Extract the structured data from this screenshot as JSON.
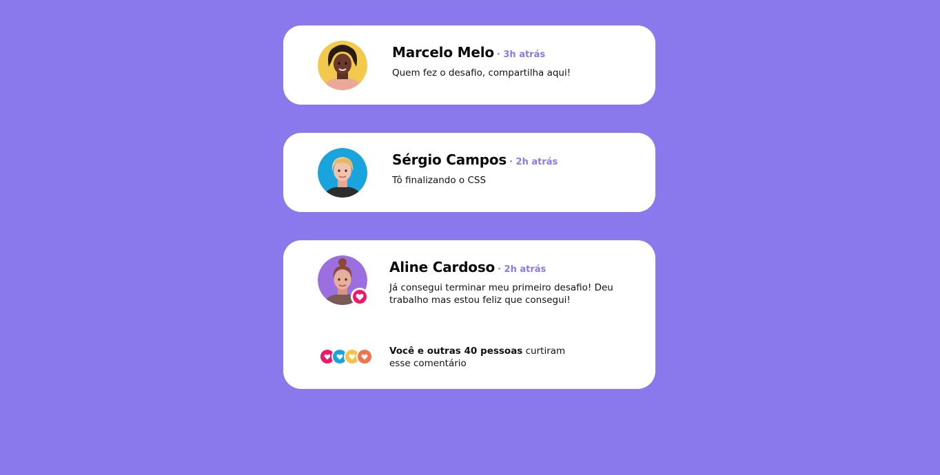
{
  "colors": {
    "background": "#8a79ed",
    "card": "#ffffff",
    "accent": "#8a79ed",
    "heart": "#f0176b"
  },
  "comments": [
    {
      "name": "Marcelo Melo",
      "time": "· 3h atrás",
      "message": "Quem fez o desafio, compartilha aqui!",
      "avatar_icon": "avatar-curly-hair-man",
      "avatar_bg": "#f2c94c"
    },
    {
      "name": "Sérgio Campos",
      "time": "· 2h atrás",
      "message": "Tô finalizando o CSS",
      "avatar_icon": "avatar-blond-man",
      "avatar_bg": "#1aa4dd"
    },
    {
      "name": "Aline Cardoso",
      "time": "· 2h atrás",
      "message": "Já consegui terminar meu primeiro desafio! Deu trabalho mas estou feliz que consegui!",
      "avatar_icon": "avatar-bun-hair-woman",
      "avatar_bg": "#9b6fe0",
      "badge_icon": "heart-icon",
      "likes": {
        "bold": "Você e outras 40 pessoas",
        "rest": " curtiram esse comentário",
        "reactions": [
          {
            "icon": "heart-icon",
            "color": "#f0176b"
          },
          {
            "icon": "heart-icon",
            "color": "#1aa4dd"
          },
          {
            "icon": "heart-icon",
            "color": "#f5c24a"
          },
          {
            "icon": "heart-icon",
            "color": "#f2744c"
          }
        ]
      }
    }
  ]
}
